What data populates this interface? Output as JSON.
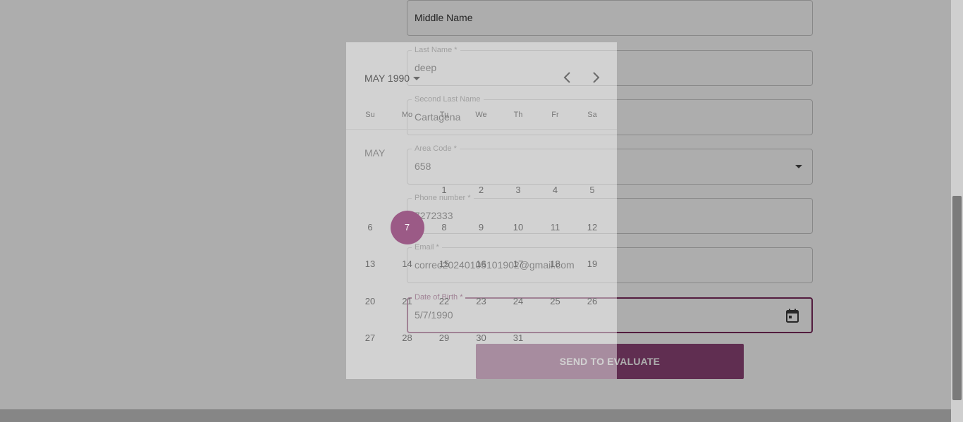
{
  "form": {
    "fields": [
      {
        "label": "",
        "value": "Middle Name"
      },
      {
        "label": "Last Name *",
        "value": "deep"
      },
      {
        "label": "Second Last Name",
        "value": "Cartagena"
      },
      {
        "label": "Area Code *",
        "value": "658"
      },
      {
        "label": "Phone number *",
        "value": "7272333"
      },
      {
        "label": "Email *",
        "value": "correo20240105101902@gmail.com"
      },
      {
        "label": "Date of Birth *",
        "value": "5/7/1990"
      }
    ],
    "submit_label": "SEND TO EVALUATE"
  },
  "calendar": {
    "month_year": "MAY 1990",
    "month_label": "MAY",
    "weekdays": [
      "Su",
      "Mo",
      "Tu",
      "We",
      "Th",
      "Fr",
      "Sa"
    ],
    "selected_day": "7",
    "weeks": [
      [
        "",
        "",
        "1",
        "2",
        "3",
        "4",
        "5"
      ],
      [
        "6",
        "7",
        "8",
        "9",
        "10",
        "11",
        "12"
      ],
      [
        "13",
        "14",
        "15",
        "16",
        "17",
        "18",
        "19"
      ],
      [
        "20",
        "21",
        "22",
        "23",
        "24",
        "25",
        "26"
      ],
      [
        "27",
        "28",
        "29",
        "30",
        "31",
        "",
        ""
      ]
    ]
  },
  "colors": {
    "accent": "#7a2a5c",
    "button": "#8e4478",
    "selected_day": "#9b5a86"
  },
  "icons": {
    "area_code_dropdown": "chevron-down-icon",
    "date_picker": "calendar-icon",
    "prev_month": "chevron-left-icon",
    "next_month": "chevron-right-icon"
  }
}
